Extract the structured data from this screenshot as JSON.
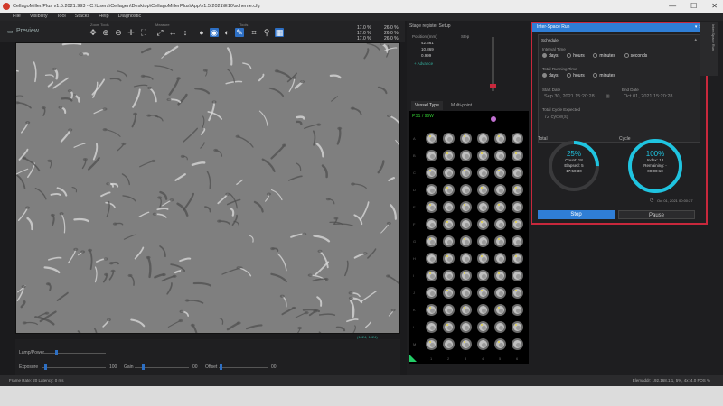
{
  "window": {
    "title": "CellagoMiller/Plus v1.5.2021.993 - C:\\Users\\Cellagen\\Desktop\\CellagoMillerPlus\\App\\v1.5.2021\\E10\\scheme.cfg",
    "minimize": "—",
    "maximize": "☐",
    "close": "✕"
  },
  "menu": [
    "File",
    "Visibility",
    "Tool",
    "Stacks",
    "Help",
    "Diagnostic"
  ],
  "toolbar": {
    "preview_tab": "Preview",
    "zoom_label": "Zoom Tools",
    "measure_label": "Measure",
    "tools_label": "Tools"
  },
  "readouts": {
    "line1": "17.0 %",
    "line2": "17.0 %",
    "line3": "17.0 %",
    "r1": "26.0 %",
    "r2": "26.0 %",
    "r3": "26.0 %"
  },
  "viewer": {
    "coord1": "(1024, 1024)",
    "coord2": "1:1"
  },
  "controls": {
    "lamp_label": "Lamp/Power",
    "exposure_label": "Exposure",
    "gain_label": "Gain",
    "offset_label": "Offset",
    "exposure_val": "100",
    "gain_val": "00",
    "offset_val": "00"
  },
  "status": {
    "left": "Frame Rate: 20     Latency: 0 ms",
    "right": "Elemaddr: 192.168.1.1, 5%, 4x: 4.0 FOS     %"
  },
  "right_panel": {
    "stage_label": "Stage register Setup",
    "position_label": "Position (mm)",
    "x_val": "42.661",
    "y_val": "10.869",
    "z_val": "0.999",
    "advance": "+ Advance",
    "step_label": "Step",
    "tab_vessel": "Vessel Type",
    "tab_multi": "Multi-point",
    "plate_name": "PS1 / 96W"
  },
  "plate": {
    "rows": [
      "A",
      "B",
      "C",
      "D",
      "E",
      "F",
      "G",
      "H",
      "I",
      "J",
      "K",
      "L",
      "M"
    ],
    "cols": [
      "1",
      "2",
      "3",
      "4",
      "5",
      "6"
    ]
  },
  "scheduler": {
    "title": "Inter-Space Run",
    "section": "Schedule",
    "interval_label": "Interval Time",
    "interval_opts": [
      "days",
      "hours",
      "minutes",
      "seconds"
    ],
    "total_label": "Total Running Time",
    "total_opts": [
      "days",
      "hours",
      "minutes"
    ],
    "start_label": "Start Date",
    "start_val": "Sep 30, 2021 15:20:28",
    "end_label": "End Date",
    "end_val": "Oct 01, 2021 15:20:28",
    "cycles_label": "Total Cycle Expected",
    "cycles_val": "72 cycle(s)",
    "total_ring_label": "Total",
    "total_pct": "25%",
    "total_sub1": "Count: 18",
    "total_sub2": "Elapsed: 5",
    "total_sub3": "17:50:30",
    "cycle_ring_label": "Cycle",
    "cycle_pct": "100%",
    "cycle_sub1": "Index: 18",
    "cycle_sub2": "Remaining: -",
    "cycle_sub3": "00:00:10",
    "next_run": "Oct 01, 2021 00:00:27",
    "stop": "Stop",
    "pause": "Pause",
    "accent": "#2f7ed6",
    "ring_color": "#1fc4e0",
    "highlight": "#c8283c"
  },
  "side_tab": "Inter-Space Run"
}
